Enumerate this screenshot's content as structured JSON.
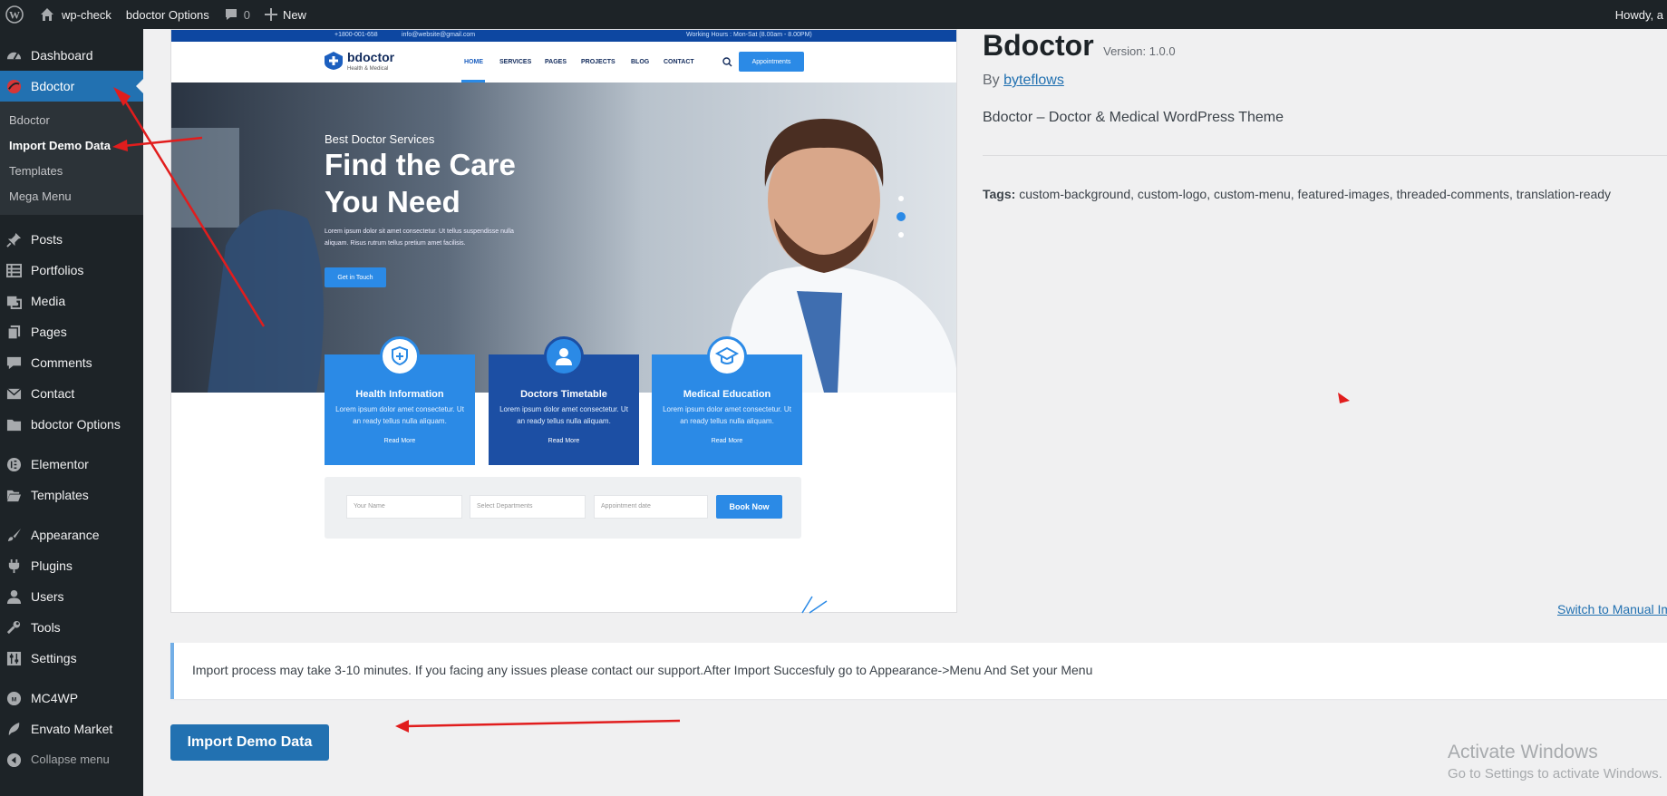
{
  "admin_bar": {
    "site_name": "wp-check",
    "options_link": "bdoctor Options",
    "comments_count": "0",
    "new_label": "New",
    "howdy": "Howdy, a"
  },
  "sidebar": {
    "dashboard": "Dashboard",
    "bdoctor": "Bdoctor",
    "submenu": [
      "Bdoctor",
      "Import Demo Data",
      "Templates",
      "Mega Menu"
    ],
    "items": [
      "Posts",
      "Portfolios",
      "Media",
      "Pages",
      "Comments",
      "Contact",
      "bdoctor Options"
    ],
    "items2": [
      "Elementor",
      "Templates"
    ],
    "items3": [
      "Appearance",
      "Plugins",
      "Users",
      "Tools",
      "Settings"
    ],
    "items4": [
      "MC4WP",
      "Envato Market"
    ],
    "collapse": "Collapse menu"
  },
  "preview": {
    "phone": "+1800-001-658",
    "email": "info@website@gmail.com",
    "hours": "Working Hours : Mon-Sat (8.00am - 8.00PM)",
    "logo": "bdoctor",
    "logo_sub": "Health & Medical",
    "nav": [
      "HOME",
      "SERVICES",
      "PAGES",
      "PROJECTS",
      "BLOG",
      "CONTACT"
    ],
    "appointments": "Appointments",
    "hero_kicker": "Best Doctor Services",
    "hero_title_1": "Find the Care",
    "hero_title_2": "You Need",
    "hero_text_1": "Lorem ipsum dolor sit amet consectetur. Ut tellus suspendisse nulla",
    "hero_text_2": "aliquam. Risus rutrum tellus pretium amet facilisis.",
    "hero_button": "Get in Touch",
    "cards": [
      {
        "title": "Health Information",
        "text_1": "Lorem ipsum dolor amet consectetur. Ut",
        "text_2": "an ready tellus nulla aliquam.",
        "link": "Read More"
      },
      {
        "title": "Doctors Timetable",
        "text_1": "Lorem ipsum dolor amet consectetur. Ut",
        "text_2": "an ready tellus nulla aliquam.",
        "link": "Read More"
      },
      {
        "title": "Medical Education",
        "text_1": "Lorem ipsum dolor amet consectetur. Ut",
        "text_2": "an ready tellus nulla aliquam.",
        "link": "Read More"
      }
    ],
    "form": {
      "name": "Your Name",
      "department": "Select Departments",
      "date": "Appointment date",
      "book": "Book Now"
    }
  },
  "theme": {
    "name": "Bdoctor",
    "version": "Version: 1.0.0",
    "by": "By",
    "author": "byteflows",
    "description": "Bdoctor – Doctor & Medical WordPress Theme",
    "tags_label": "Tags:",
    "tags": "custom-background, custom-logo, custom-menu, featured-images, threaded-comments, translation-ready",
    "switch_link": "Switch to Manual Im"
  },
  "notice": "Import process may take 3-10 minutes. If you facing any issues please contact our support.After Import Succesfuly go to Appearance->Menu And Set your Menu",
  "import_button": "Import Demo Data",
  "watermark": {
    "title": "Activate Windows",
    "subtitle": "Go to Settings to activate Windows."
  },
  "colors": {
    "admin_dark": "#1d2327",
    "wp_blue": "#2271b1",
    "annotation_red": "#e11d1d"
  }
}
